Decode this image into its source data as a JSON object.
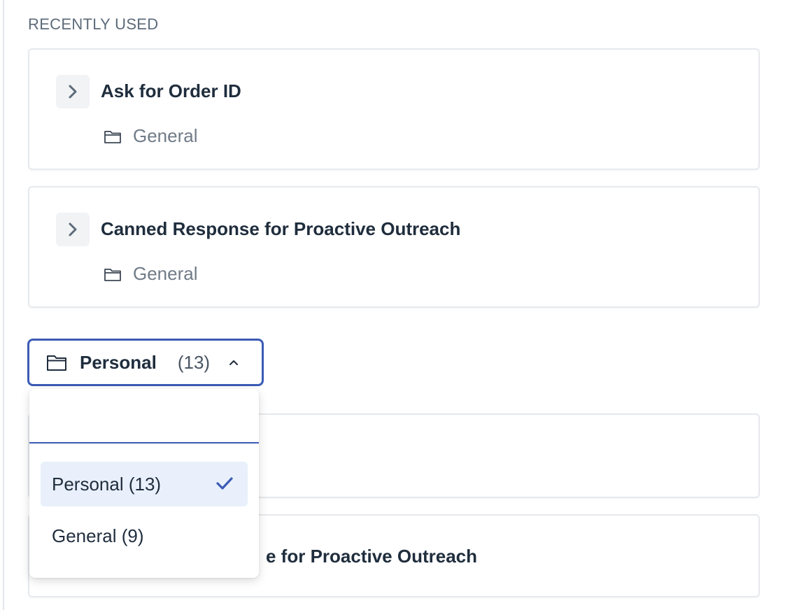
{
  "section_title": "RECENTLY USED",
  "recent": [
    {
      "title": "Ask for Order ID",
      "folder": "General",
      "icon": "folder-icon"
    },
    {
      "title": "Canned Response for Proactive Outreach",
      "folder": "General",
      "icon": "folder-icon"
    }
  ],
  "folder_selector": {
    "name": "Personal",
    "count": "(13)",
    "search_value": ""
  },
  "dropdown": {
    "options": [
      {
        "label": "Personal (13)",
        "selected": true
      },
      {
        "label": "General (9)",
        "selected": false
      }
    ]
  },
  "list_behind": {
    "visible_title_fragment": "e for Proactive Outreach"
  },
  "colors": {
    "accent": "#3b5bb5",
    "selected_bg": "#e9f0fb"
  }
}
